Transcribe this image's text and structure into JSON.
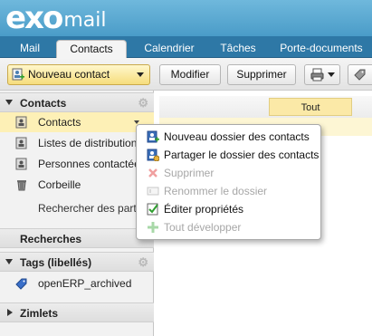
{
  "app": {
    "logo_main": "exo",
    "logo_suffix": "mail"
  },
  "tabs": [
    {
      "label": "Mail",
      "active": false
    },
    {
      "label": "Contacts",
      "active": true
    },
    {
      "label": "Calendrier",
      "active": false
    },
    {
      "label": "Tâches",
      "active": false
    },
    {
      "label": "Porte-documents",
      "active": false
    }
  ],
  "toolbar": {
    "new_contact": "Nouveau contact",
    "modify": "Modifier",
    "delete": "Supprimer"
  },
  "sidebar": {
    "contacts_header": "Contacts",
    "items": [
      {
        "label": "Contacts",
        "icon": "address-book-icon"
      },
      {
        "label": "Listes de distribution",
        "icon": "list-icon"
      },
      {
        "label": "Personnes contactées",
        "icon": "people-icon"
      },
      {
        "label": "Corbeille",
        "icon": "trash-icon"
      }
    ],
    "search_shared": "Rechercher des partages",
    "searches_header": "Recherches",
    "tags_header": "Tags (libellés)",
    "tag_items": [
      {
        "label": "openERP_archived",
        "icon": "tag-icon"
      }
    ],
    "zimlets_header": "Zimlets"
  },
  "main": {
    "filter_all": "Tout"
  },
  "context_menu": [
    {
      "label": "Nouveau dossier des contacts",
      "enabled": true,
      "icon": "new-folder-icon"
    },
    {
      "label": "Partager le dossier des contacts",
      "enabled": true,
      "icon": "share-folder-icon"
    },
    {
      "label": "Supprimer",
      "enabled": false,
      "icon": "delete-x-icon"
    },
    {
      "label": "Renommer le dossier",
      "enabled": false,
      "icon": "rename-icon"
    },
    {
      "label": "Éditer propriétés",
      "enabled": true,
      "icon": "edit-properties-icon"
    },
    {
      "label": "Tout développer",
      "enabled": false,
      "icon": "expand-all-icon"
    }
  ],
  "colors": {
    "header_blue": "#4a9cc8",
    "tab_bar": "#2e78a6",
    "highlight": "#fdf0b6"
  }
}
